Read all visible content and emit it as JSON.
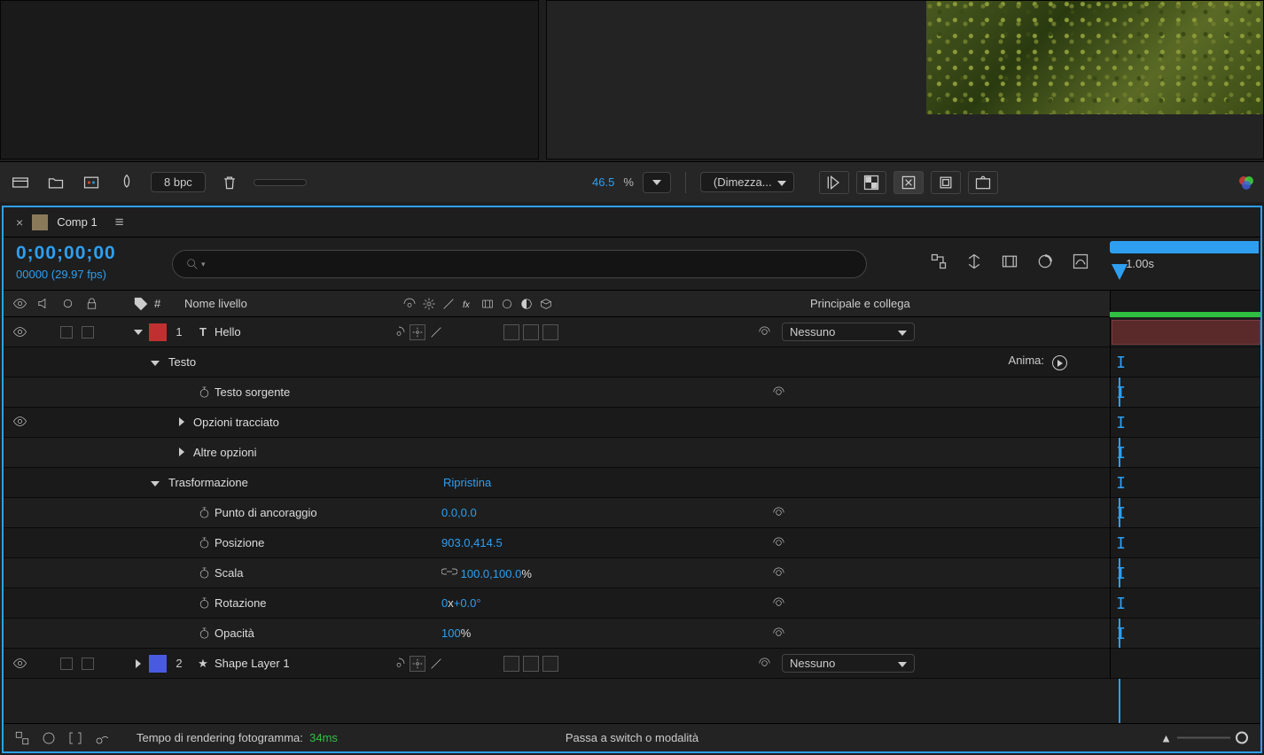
{
  "top": {
    "bpc": "8 bpc",
    "zoom_value": "46.5",
    "zoom_pct": "%",
    "quality": "(Dimezza..."
  },
  "panel": {
    "tab_name": "Comp 1",
    "timecode": "0;00;00;00",
    "fps": "00000 (29.97 fps)",
    "ruler_label": "1.00s"
  },
  "columns": {
    "num": "#",
    "name": "Nome livello",
    "parent": "Principale e collega"
  },
  "layer1": {
    "num": "1",
    "type": "T",
    "name": "Hello",
    "parent": "Nessuno",
    "groups": {
      "text": "Testo",
      "transform": "Trasformazione"
    },
    "anima": "Anima:",
    "props": {
      "source_text": "Testo sorgente",
      "path_options": "Opzioni tracciato",
      "more_options": "Altre opzioni",
      "transform_reset": "Ripristina",
      "anchor": {
        "label": "Punto di ancoraggio",
        "val": "0.0,0.0"
      },
      "position": {
        "label": "Posizione",
        "val": "903.0,414.5"
      },
      "scale": {
        "label": "Scala",
        "val": "100.0,100.0",
        "unit": "%"
      },
      "rotation": {
        "label": "Rotazione",
        "pre": "0",
        "mid": "x",
        "post": "+0.0°"
      },
      "opacity": {
        "label": "Opacità",
        "val": "100",
        "unit": "%"
      }
    }
  },
  "layer2": {
    "num": "2",
    "type": "★",
    "name": "Shape Layer 1",
    "parent": "Nessuno"
  },
  "footer": {
    "render_label": "Tempo di rendering fotogramma:",
    "render_ms": "34ms",
    "switch": "Passa a switch o modalità"
  }
}
